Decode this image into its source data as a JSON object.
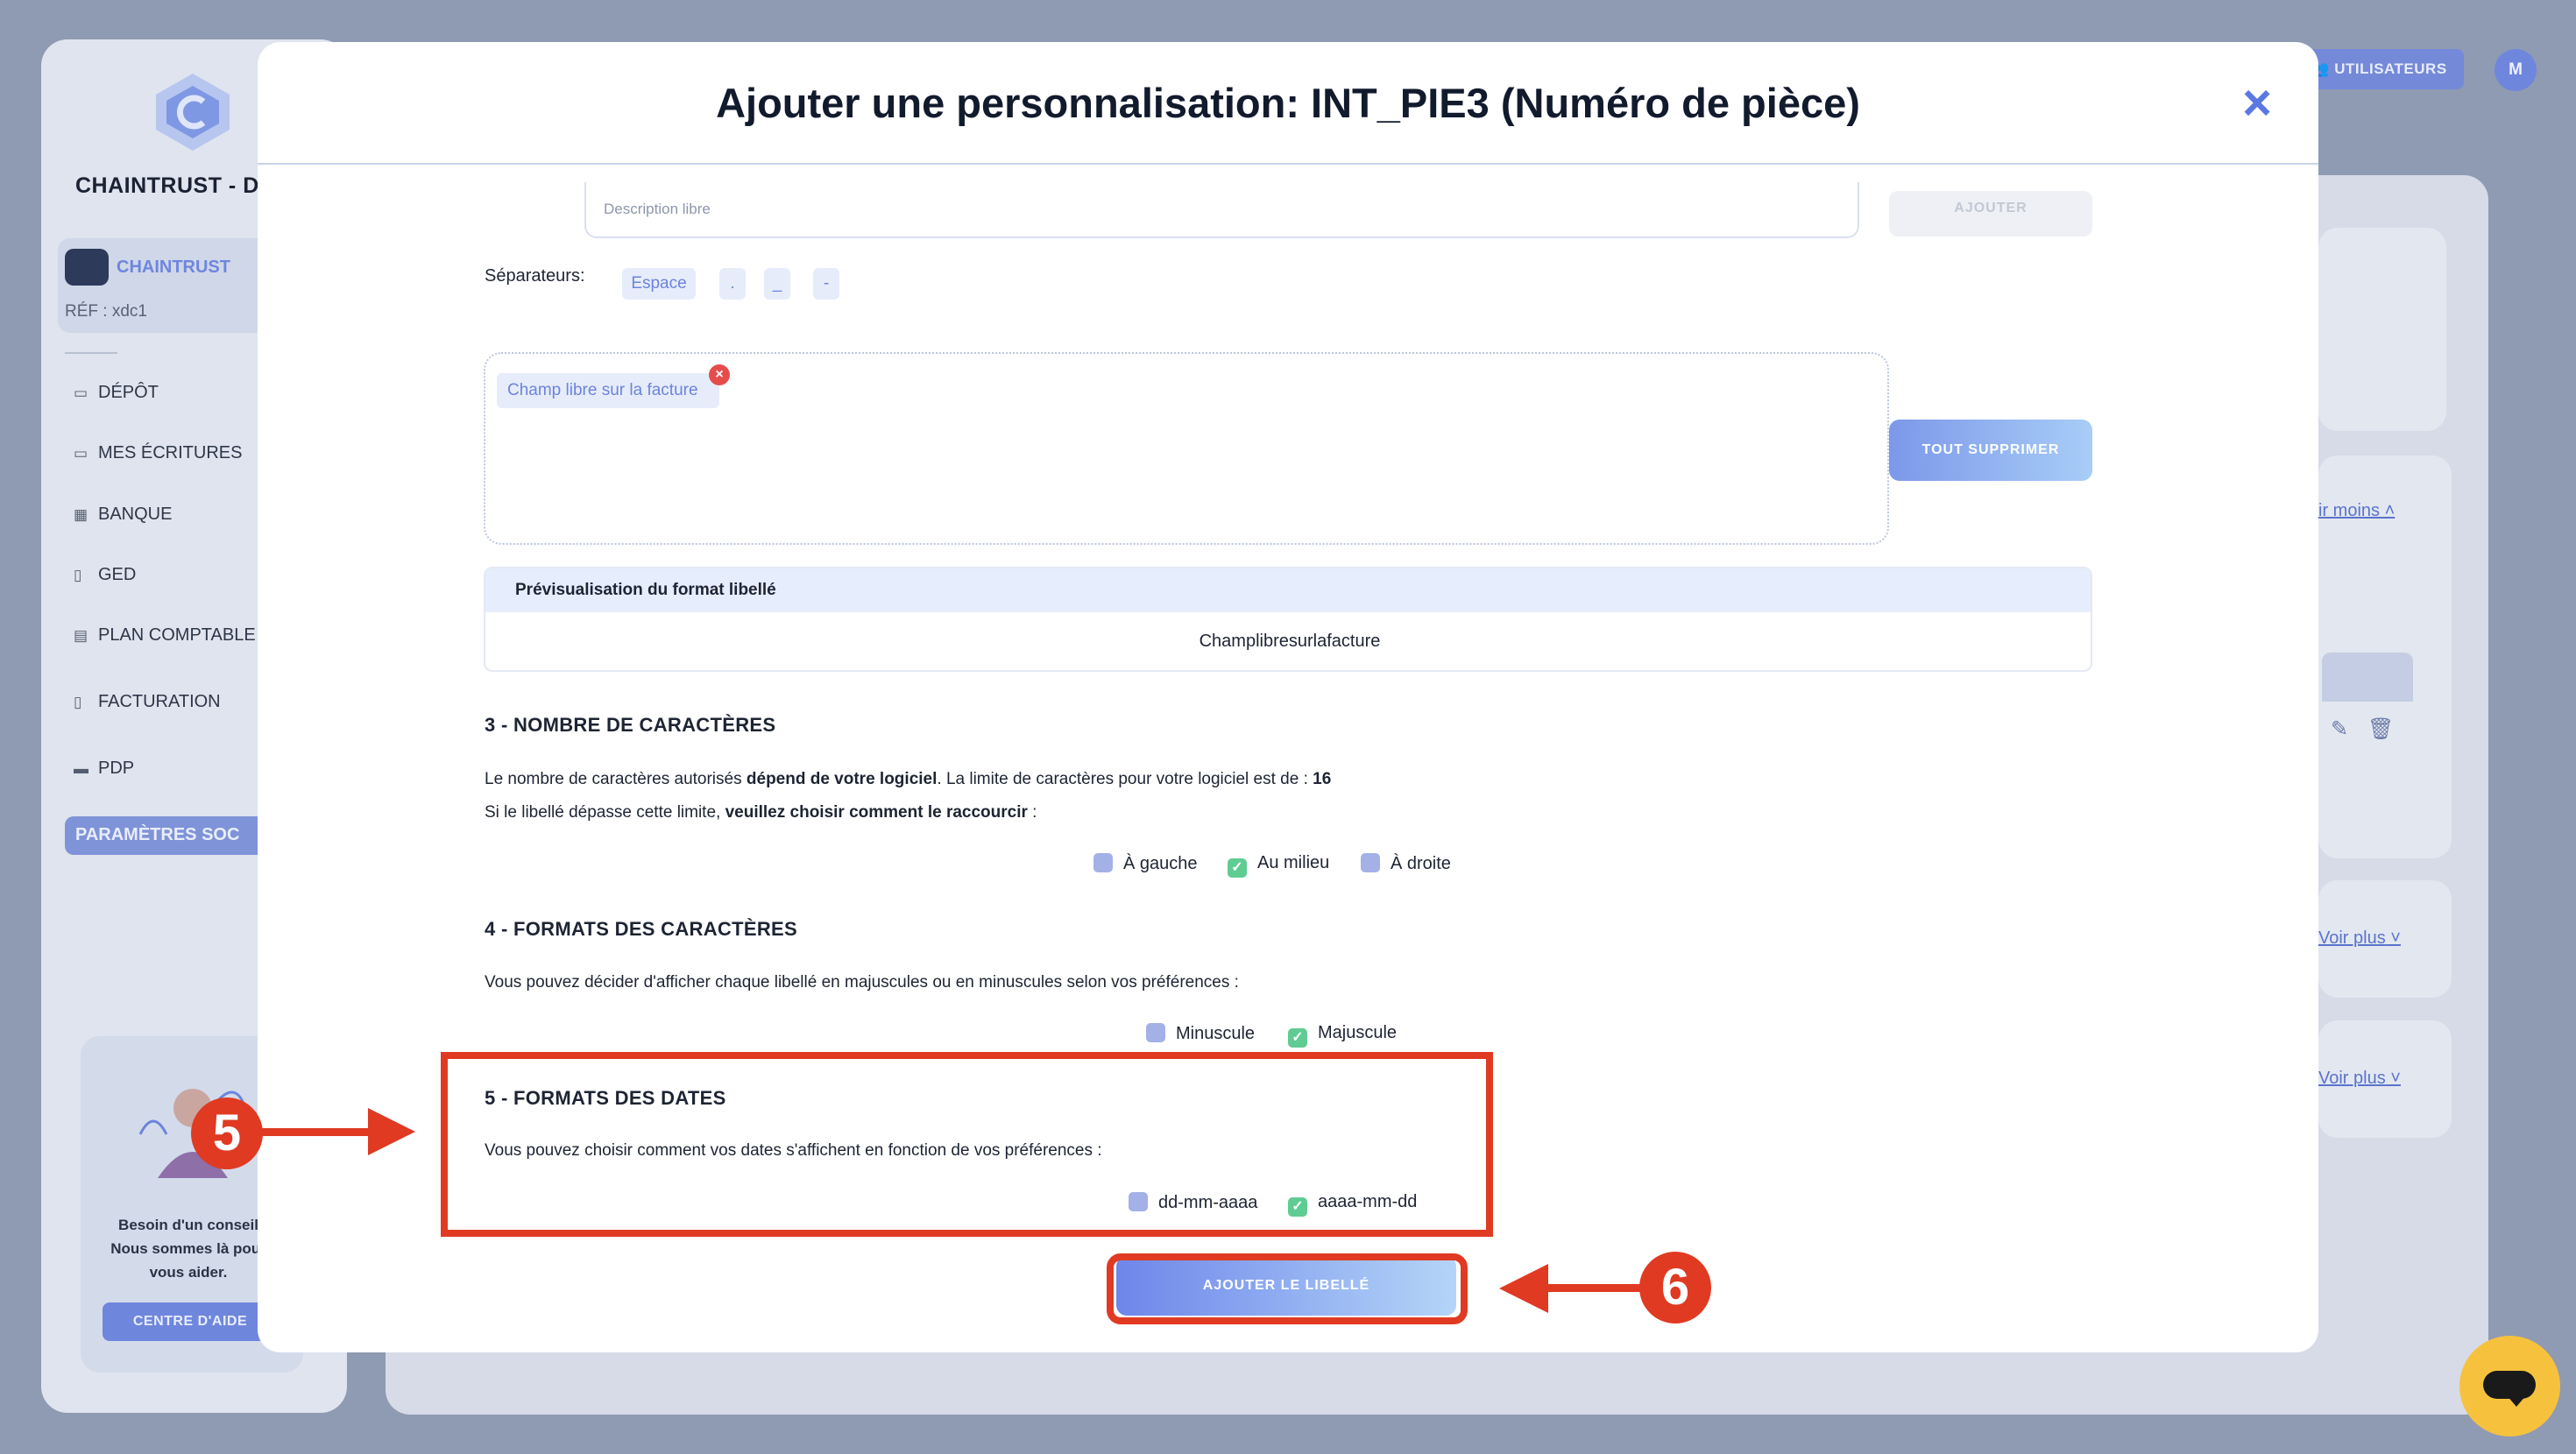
{
  "background": {
    "company_name": "CHAINTRUST - D",
    "account": {
      "name": "CHAINTRUST",
      "ref": "RÉF : xdc1"
    },
    "nav": [
      {
        "label": "DÉPÔT",
        "icon": "folder-icon"
      },
      {
        "label": "MES ÉCRITURES",
        "icon": "folder-icon"
      },
      {
        "label": "BANQUE",
        "icon": "bank-icon"
      },
      {
        "label": "GED",
        "icon": "document-icon"
      },
      {
        "label": "PLAN COMPTABLE",
        "icon": "ledger-icon"
      },
      {
        "label": "FACTURATION",
        "icon": "invoice-icon"
      },
      {
        "label": "PDP",
        "icon": "card-icon"
      }
    ],
    "active_nav": "PARAMÈTRES SOC",
    "help": {
      "text": "Besoin d'un conseil Nous sommes là pour vous aider.",
      "button": "CENTRE D'AIDE"
    },
    "header": {
      "users_button": "UTILISATEURS",
      "avatar_initial": "M"
    },
    "links": {
      "see_less": "ir moins",
      "see_more_1": "Voir plus",
      "see_more_2": "Voir plus"
    }
  },
  "modal": {
    "title": "Ajouter une personnalisation: INT_PIE3 (Numéro de pièce)",
    "close_icon": "close-icon",
    "description_placeholder": "Description libre",
    "add_button": "AJOUTER",
    "separators_label": "Séparateurs:",
    "separators": [
      "Espace",
      ".",
      "_",
      "-"
    ],
    "tags": [
      "Champ libre sur la facture"
    ],
    "clear_all_button": "TOUT SUPPRIMER",
    "preview": {
      "header": "Prévisualisation du format libellé",
      "value": "Champlibresurlafacture"
    },
    "section3": {
      "title": "3 - NOMBRE DE CARACTÈRES",
      "line1_a": "Le nombre de caractères autorisés ",
      "line1_b": "dépend de votre logiciel",
      "line1_c": ". La limite de caractères pour votre logiciel est de : ",
      "line1_d": "16",
      "line2_a": "Si le libellé dépasse cette limite, ",
      "line2_b": "veuillez choisir comment le raccourcir",
      "line2_c": " :",
      "options": [
        {
          "label": "À gauche",
          "checked": false
        },
        {
          "label": "Au milieu",
          "checked": true
        },
        {
          "label": "À droite",
          "checked": false
        }
      ]
    },
    "section4": {
      "title": "4 - FORMATS DES CARACTÈRES",
      "text": "Vous pouvez décider d'afficher chaque libellé en majuscules ou en minuscules selon vos préférences :",
      "options": [
        {
          "label": "Minuscule",
          "checked": false
        },
        {
          "label": "Majuscule",
          "checked": true
        }
      ]
    },
    "section5": {
      "title": "5 - FORMATS DES DATES",
      "text": "Vous pouvez choisir comment vos dates s'affichent en fonction de vos préférences :",
      "options": [
        {
          "label": "dd-mm-aaaa",
          "checked": false
        },
        {
          "label": "aaaa-mm-dd",
          "checked": true
        }
      ]
    },
    "submit_button": "AJOUTER LE LIBELLÉ"
  },
  "annotations": {
    "step5": "5",
    "step6": "6"
  },
  "colors": {
    "accent": "#6b84dd",
    "annotation": "#e03a22",
    "checked": "#5fcc93",
    "unchecked": "#a3b1e6",
    "chat": "#f6c23e"
  }
}
